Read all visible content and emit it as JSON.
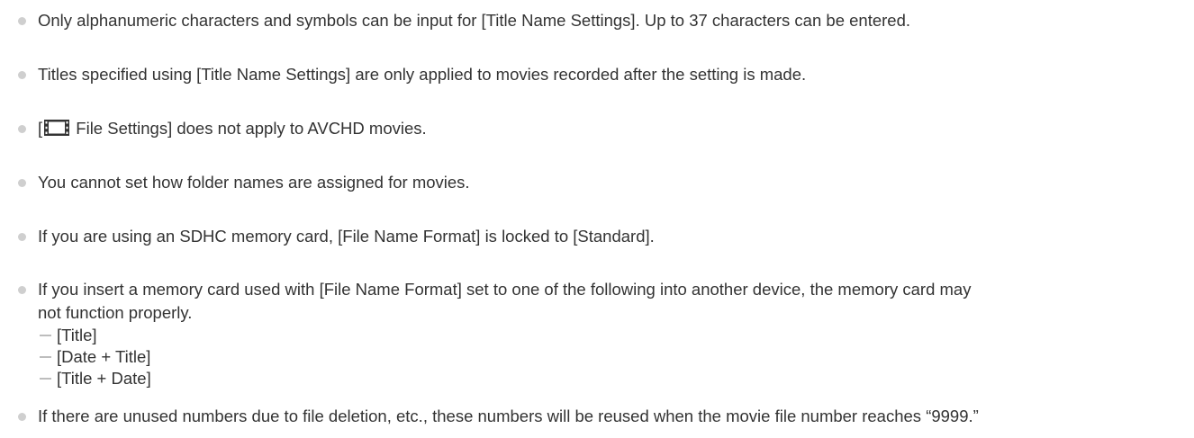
{
  "notes": [
    {
      "text": "Only alphanumeric characters and symbols can be input for [Title Name Settings]. Up to 37 characters can be entered."
    },
    {
      "text": "Titles specified using [Title Name Settings] are only applied to movies recorded after the setting is made."
    },
    {
      "prefix": "[",
      "icon": "film-icon",
      "suffix": " File Settings] does not apply to AVCHD movies."
    },
    {
      "text": "You cannot set how folder names are assigned for movies."
    },
    {
      "text": "If you are using an SDHC memory card, [File Name Format] is locked to [Standard]."
    },
    {
      "line1": "If you insert a memory card used with [File Name Format] set to one of the following into another device, the memory card may",
      "line2": "not function properly.",
      "subitems": [
        "[Title]",
        "[Date + Title]",
        "[Title + Date]"
      ]
    },
    {
      "text": "If there are unused numbers due to file deletion, etc., these numbers will be reused when the movie file number reaches “9999.”"
    }
  ],
  "colors": {
    "text": "#333333",
    "bullet": "#cfcfcf",
    "dash": "#bdbdbd"
  }
}
